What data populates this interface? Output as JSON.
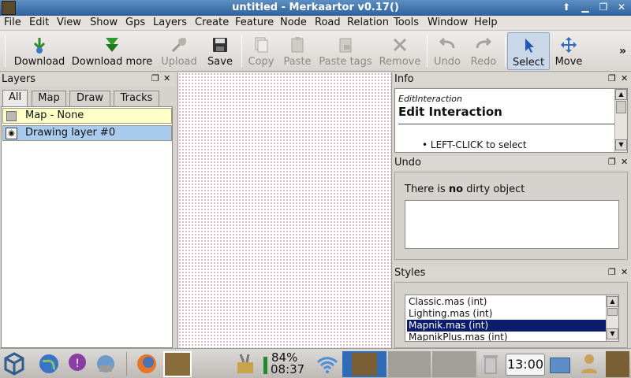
{
  "window": {
    "title": "untitled - Merkaartor v0.17()",
    "buttons": [
      "⬆",
      "✕",
      "❐",
      "✕"
    ]
  },
  "menu": [
    "File",
    "Edit",
    "View",
    "Show",
    "Gps",
    "Layers",
    "Create",
    "Feature",
    "Node",
    "Road",
    "Relation",
    "Tools",
    "Window",
    "Help"
  ],
  "toolbar": {
    "download": "Download",
    "download_more": "Download more",
    "upload": "Upload",
    "save": "Save",
    "copy": "Copy",
    "paste": "Paste",
    "paste_tags": "Paste tags",
    "remove": "Remove",
    "undo": "Undo",
    "redo": "Redo",
    "select": "Select",
    "move": "Move",
    "more": "»"
  },
  "layers": {
    "title": "Layers",
    "tabs": [
      "All",
      "Map",
      "Draw",
      "Tracks"
    ],
    "items": [
      "Map - None",
      "Drawing layer #0"
    ]
  },
  "info": {
    "title": "Info",
    "small": "EditInteraction",
    "heading": "Edit Interaction",
    "bullet": "• LEFT-CLICK to select"
  },
  "undo": {
    "title": "Undo",
    "text_pre": "There is ",
    "text_bold": "no",
    "text_post": " dirty object"
  },
  "styles": {
    "title": "Styles",
    "items": [
      "Classic.mas (int)",
      "Lighting.mas (int)",
      "Mapnik.mas (int)",
      "MapnikPlus.mas (int)"
    ],
    "selected_index": 2
  },
  "taskbar": {
    "battery": "84%",
    "battery_time": "08:37",
    "clock": "13:00"
  },
  "dock_buttons": {
    "float": "❐",
    "close": "✕"
  },
  "colors": {
    "titlebar": "#3a6ea8",
    "selected": "#0a1c6b",
    "layer_map": "#ffffc8",
    "layer_draw": "#a8cbee"
  }
}
